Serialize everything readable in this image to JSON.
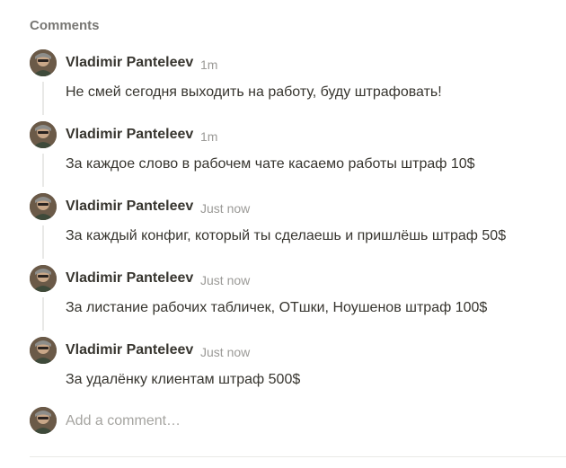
{
  "section": {
    "title": "Comments"
  },
  "comments": [
    {
      "author": "Vladimir Panteleev",
      "time": "1m",
      "text": "Не смей сегодня выходить на работу, буду штрафовать!"
    },
    {
      "author": "Vladimir Panteleev",
      "time": "1m",
      "text": "За каждое слово в рабочем чате касаемо работы штраф 10$"
    },
    {
      "author": "Vladimir Panteleev",
      "time": "Just now",
      "text": "За каждый конфиг, который ты сделаешь и пришлёшь штраф 50$"
    },
    {
      "author": "Vladimir Panteleev",
      "time": "Just now",
      "text": "За листание рабочих табличек, ОТшки, Ноушенов штраф 100$"
    },
    {
      "author": "Vladimir Panteleev",
      "time": "Just now",
      "text": "За удалёнку клиентам штраф 500$"
    }
  ],
  "composer": {
    "placeholder": "Add a comment…"
  },
  "colors": {
    "text": "#37352f",
    "muted": "#9b9a97",
    "title": "#787774",
    "placeholder": "#a5a4a0",
    "line": "#e9e9e7"
  }
}
